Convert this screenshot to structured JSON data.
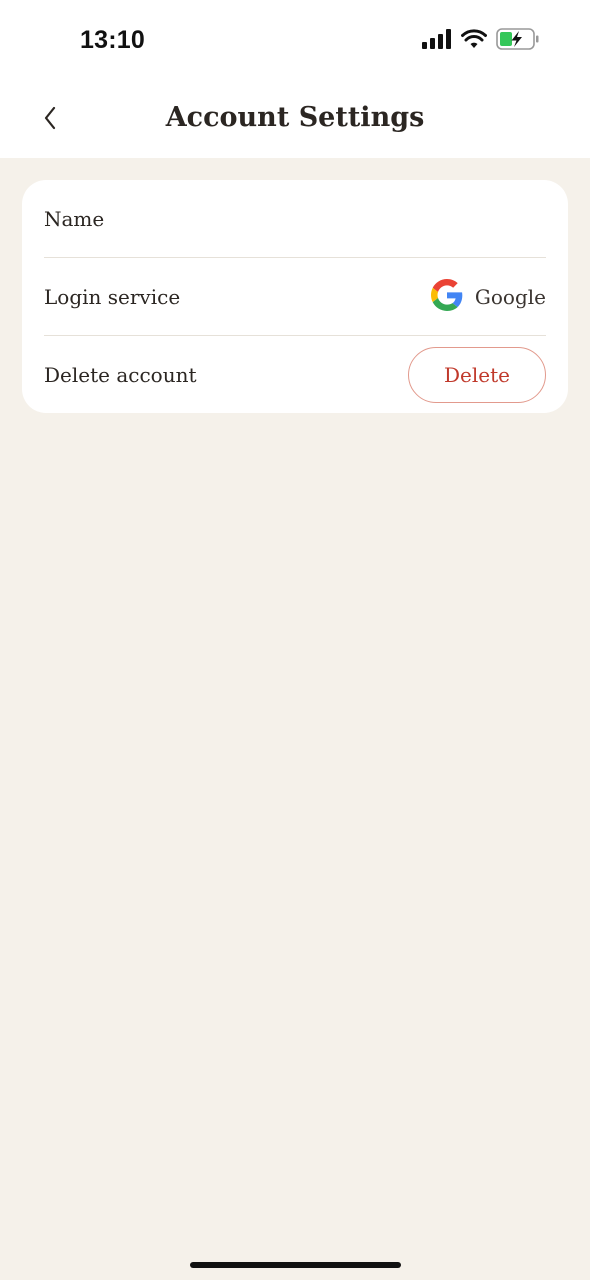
{
  "status_bar": {
    "time": "13:10",
    "icons": [
      "signal-icon",
      "wifi-icon",
      "battery-charging-icon"
    ]
  },
  "header": {
    "back_icon": "chevron-left-icon",
    "title": "Account Settings"
  },
  "settings": {
    "name_label": "Name",
    "name_value": "",
    "login_label": "Login service",
    "login_icon": "google-icon",
    "login_value": "Google",
    "delete_label": "Delete account",
    "delete_button": "Delete"
  },
  "colors": {
    "background": "#F5F1EA",
    "card": "#FFFFFF",
    "danger": "#C0392B",
    "battery_green": "#34C759"
  }
}
